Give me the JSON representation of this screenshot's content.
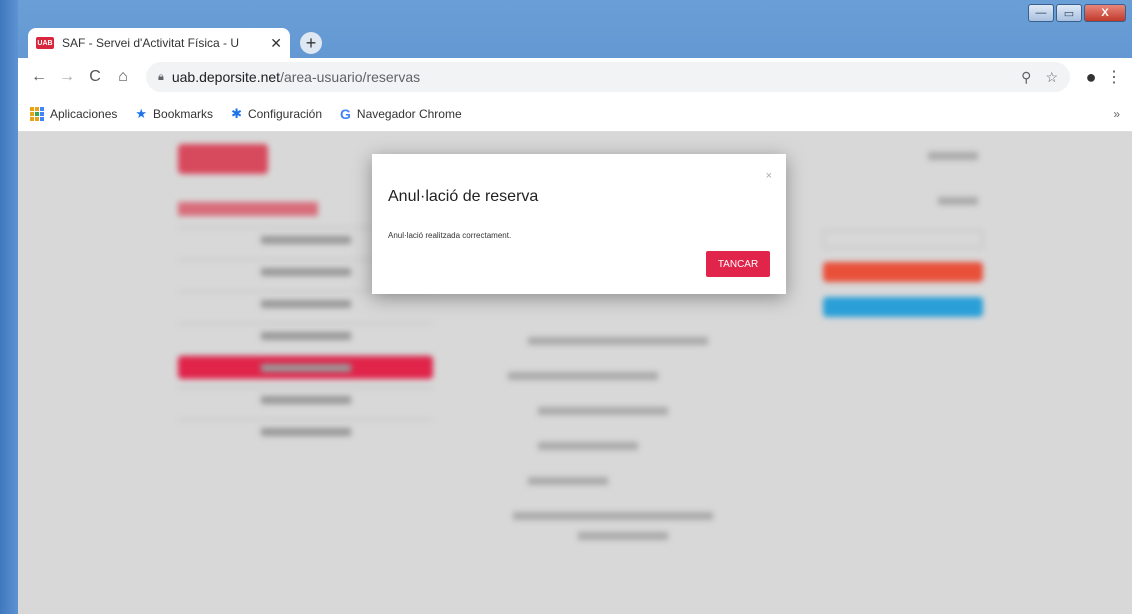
{
  "window": {
    "minimize": "—",
    "maximize": "▭",
    "close": "X"
  },
  "tab": {
    "favicon_text": "UAB",
    "title": "SAF - Servei d'Activitat Física - U",
    "close": "✕"
  },
  "toolbar": {
    "url_host": "uab.deporsite.net",
    "url_path": "/area-usuario/reservas"
  },
  "bookmarks": {
    "items": [
      {
        "label": "Aplicaciones"
      },
      {
        "label": "Bookmarks"
      },
      {
        "label": "Configuración"
      },
      {
        "label": "Navegador Chrome"
      }
    ],
    "more": "»"
  },
  "modal": {
    "title": "Anul·lació de reserva",
    "message": "Anul·lació realitzada correctament.",
    "button": "TANCAR",
    "close": "×"
  },
  "colors": {
    "accent": "#e0244a",
    "blue": "#2a9fd8",
    "orange": "#e8503a"
  }
}
